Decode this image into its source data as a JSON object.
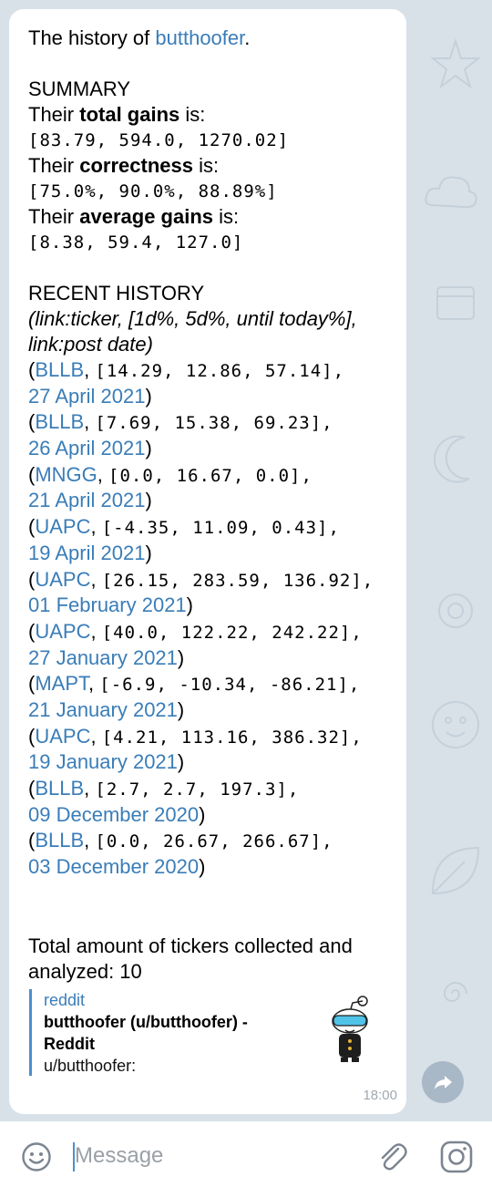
{
  "message": {
    "intro_prefix": "The history of ",
    "intro_user": "butthoofer",
    "intro_suffix": ".",
    "summary": {
      "heading": "SUMMARY",
      "total_gains_pre": "Their ",
      "total_gains_label": "total gains",
      "total_gains_post": " is:",
      "total_gains_values": "[83.79, 594.0, 1270.02]",
      "correctness_pre": "Their ",
      "correctness_label": "correctness",
      "correctness_post": " is:",
      "correctness_values": "[75.0%, 90.0%, 88.89%]",
      "average_gains_pre": "Their ",
      "average_gains_label": "average gains",
      "average_gains_post": " is:",
      "average_gains_values": "[8.38, 59.4, 127.0]"
    },
    "recent": {
      "heading": "RECENT HISTORY",
      "format_line1": "(link:ticker, [1d%, 5d%, until today%],",
      "format_line2": "link:post date)",
      "entries": [
        {
          "ticker": "BLLB",
          "values": "[14.29, 12.86, 57.14],",
          "date": "27 April 2021"
        },
        {
          "ticker": "BLLB",
          "values": "[7.69, 15.38, 69.23],",
          "date": "26 April 2021"
        },
        {
          "ticker": "MNGG",
          "values": "[0.0, 16.67, 0.0],",
          "date": "21 April 2021"
        },
        {
          "ticker": "UAPC",
          "values": "[-4.35, 11.09, 0.43],",
          "date": "19 April 2021"
        },
        {
          "ticker": "UAPC",
          "values": "[26.15, 283.59, 136.92],",
          "date": "01 February 2021"
        },
        {
          "ticker": "UAPC",
          "values": "[40.0, 122.22, 242.22],",
          "date": "27 January 2021"
        },
        {
          "ticker": "MAPT",
          "values": "[-6.9, -10.34, -86.21],",
          "date": "21 January 2021"
        },
        {
          "ticker": "UAPC",
          "values": "[4.21, 113.16, 386.32],",
          "date": "19 January 2021"
        },
        {
          "ticker": "BLLB",
          "values": "[2.7, 2.7, 197.3],",
          "date": "09 December 2020"
        },
        {
          "ticker": "BLLB",
          "values": "[0.0, 26.67, 266.67],",
          "date": "03 December 2020"
        }
      ]
    },
    "total_text": "Total amount of tickers collected and analyzed: 10",
    "preview": {
      "site": "reddit",
      "title": "butthoofer (u/butthoofer) - Reddit",
      "description": "u/butthoofer:"
    },
    "time": "18:00"
  },
  "input": {
    "placeholder": "Message"
  },
  "icons": {
    "emoji": "emoji-icon",
    "attach": "paperclip-icon",
    "camera": "instagram-camera-icon",
    "share": "share-arrow-icon"
  },
  "colors": {
    "link": "#3a7db8",
    "chat_background": "#d8e1e8",
    "share_button": "#a9b8c6",
    "caret": "#4a90cf"
  }
}
